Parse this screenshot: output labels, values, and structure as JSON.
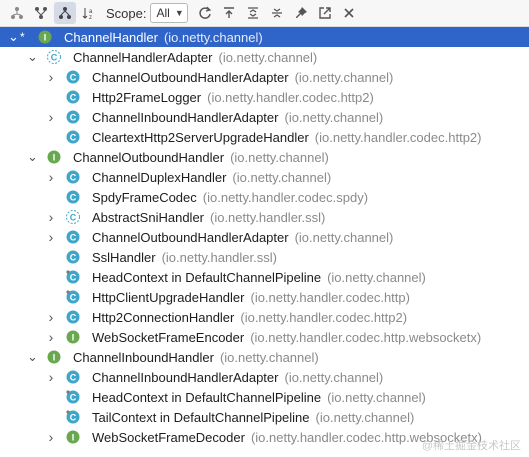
{
  "toolbar": {
    "scope_label": "Scope:",
    "scope_value": "All",
    "tools": [
      {
        "icon": "supertypes-hierarchy-icon"
      },
      {
        "icon": "subtypes-hierarchy-icon"
      },
      {
        "icon": "class-hierarchy-icon"
      },
      {
        "icon": "sort-alphabetically-icon"
      }
    ],
    "actions": [
      {
        "icon": "refresh-icon"
      },
      {
        "icon": "export-icon"
      },
      {
        "icon": "expand-all-icon"
      },
      {
        "icon": "collapse-all-icon"
      },
      {
        "icon": "pin-icon"
      },
      {
        "icon": "open-in-window-icon"
      },
      {
        "icon": "close-icon"
      }
    ]
  },
  "tree": [
    {
      "depth": 0,
      "expand": "open",
      "kind": "I",
      "star": true,
      "name": "ChannelHandler",
      "pkg": "(io.netty.channel)",
      "selected": true
    },
    {
      "depth": 1,
      "expand": "open",
      "kind": "CA",
      "name": "ChannelHandlerAdapter",
      "pkg": "(io.netty.channel)"
    },
    {
      "depth": 2,
      "expand": "closed",
      "kind": "C",
      "name": "ChannelOutboundHandlerAdapter",
      "pkg": "(io.netty.channel)"
    },
    {
      "depth": 2,
      "expand": "none",
      "kind": "C",
      "name": "Http2FrameLogger",
      "pkg": "(io.netty.handler.codec.http2)"
    },
    {
      "depth": 2,
      "expand": "closed",
      "kind": "C",
      "name": "ChannelInboundHandlerAdapter",
      "pkg": "(io.netty.channel)"
    },
    {
      "depth": 2,
      "expand": "none",
      "kind": "C",
      "name": "CleartextHttp2ServerUpgradeHandler",
      "pkg": "(io.netty.handler.codec.http2)"
    },
    {
      "depth": 1,
      "expand": "open",
      "kind": "I",
      "name": "ChannelOutboundHandler",
      "pkg": "(io.netty.channel)"
    },
    {
      "depth": 2,
      "expand": "closed",
      "kind": "C",
      "name": "ChannelDuplexHandler",
      "pkg": "(io.netty.channel)"
    },
    {
      "depth": 2,
      "expand": "none",
      "kind": "C",
      "name": "SpdyFrameCodec",
      "pkg": "(io.netty.handler.codec.spdy)"
    },
    {
      "depth": 2,
      "expand": "closed",
      "kind": "CA",
      "name": "AbstractSniHandler",
      "pkg": "(io.netty.handler.ssl)"
    },
    {
      "depth": 2,
      "expand": "closed",
      "kind": "C",
      "name": "ChannelOutboundHandlerAdapter",
      "pkg": "(io.netty.channel)"
    },
    {
      "depth": 2,
      "expand": "none",
      "kind": "C",
      "name": "SslHandler",
      "pkg": "(io.netty.handler.ssl)"
    },
    {
      "depth": 2,
      "expand": "none",
      "kind": "Cf",
      "name": "HeadContext in DefaultChannelPipeline",
      "pkg": "(io.netty.channel)"
    },
    {
      "depth": 2,
      "expand": "none",
      "kind": "Cf",
      "name": "HttpClientUpgradeHandler",
      "pkg": "(io.netty.handler.codec.http)"
    },
    {
      "depth": 2,
      "expand": "closed",
      "kind": "C",
      "name": "Http2ConnectionHandler",
      "pkg": "(io.netty.handler.codec.http2)"
    },
    {
      "depth": 2,
      "expand": "closed",
      "kind": "I",
      "name": "WebSocketFrameEncoder",
      "pkg": "(io.netty.handler.codec.http.websocketx)"
    },
    {
      "depth": 1,
      "expand": "open",
      "kind": "I",
      "name": "ChannelInboundHandler",
      "pkg": "(io.netty.channel)"
    },
    {
      "depth": 2,
      "expand": "closed",
      "kind": "C",
      "name": "ChannelInboundHandlerAdapter",
      "pkg": "(io.netty.channel)"
    },
    {
      "depth": 2,
      "expand": "none",
      "kind": "Cf",
      "name": "HeadContext in DefaultChannelPipeline",
      "pkg": "(io.netty.channel)"
    },
    {
      "depth": 2,
      "expand": "none",
      "kind": "Cf",
      "name": "TailContext in DefaultChannelPipeline",
      "pkg": "(io.netty.channel)"
    },
    {
      "depth": 2,
      "expand": "closed",
      "kind": "I",
      "name": "WebSocketFrameDecoder",
      "pkg": "(io.netty.handler.codec.http.websocketx)"
    }
  ],
  "watermark": "@稀土掘金技术社区",
  "colors": {
    "selection": "#2f64c8",
    "class_icon": "#3fa6c9",
    "interface_icon": "#6aa84f",
    "lock": "#4a9a3f"
  }
}
